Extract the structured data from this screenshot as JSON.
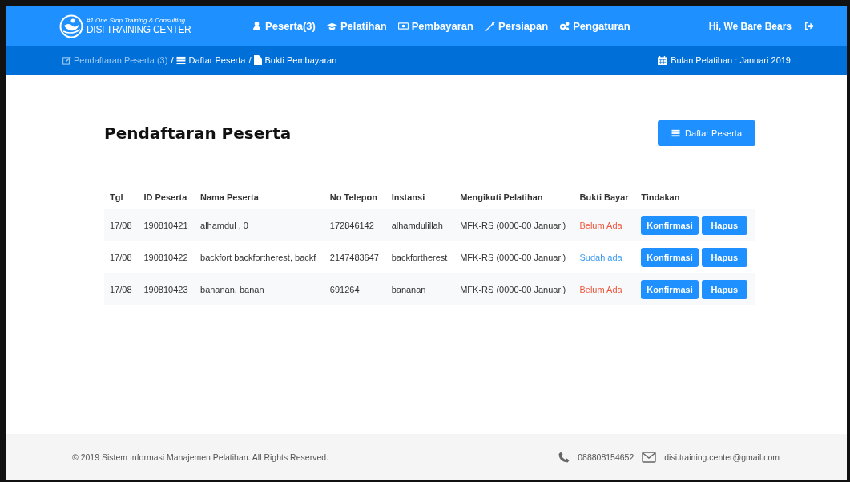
{
  "brand": {
    "tagline": "#1 One Stop Training & Consulting",
    "name": "DISI TRAINING CENTER"
  },
  "nav": [
    {
      "label": "Peserta(3)"
    },
    {
      "label": "Pelatihan"
    },
    {
      "label": "Pembayaran"
    },
    {
      "label": "Persiapan"
    },
    {
      "label": "Pengaturan"
    }
  ],
  "user": {
    "greeting": "Hi, We Bare Bears"
  },
  "breadcrumb": [
    {
      "label": "Pendaftaran Peserta (3)",
      "link": true
    },
    {
      "label": "Daftar Peserta",
      "link": false
    },
    {
      "label": "Bukti Pembayaran",
      "link": false
    }
  ],
  "breadcrumb_separator": "/",
  "period": "Bulan Pelatihan : Januari 2019",
  "page_title": "Pendaftaran Peserta",
  "list_button": "Daftar Peserta",
  "table": {
    "columns": [
      "Tgl",
      "ID Peserta",
      "Nama Peserta",
      "No Telepon",
      "Instansi",
      "Mengikuti Pelatihan",
      "Bukti Bayar",
      "Tindakan"
    ],
    "rows": [
      {
        "tgl": "17/08",
        "id": "190810421",
        "nama": "alhamdul , 0",
        "telepon": "172846142",
        "instansi": "alhamdulillah",
        "pelatihan": "MFK-RS (0000-00 Januari)",
        "bukti": "Belum Ada",
        "paid": false,
        "actions": [
          "Konfirmasi",
          "Hapus"
        ]
      },
      {
        "tgl": "17/08",
        "id": "190810422",
        "nama": "backfort backfortherest, backf",
        "telepon": "2147483647",
        "instansi": "backfortherest",
        "pelatihan": "MFK-RS (0000-00 Januari)",
        "bukti": "Sudah ada",
        "paid": true,
        "actions": [
          "Konfirmasi",
          "Hapus"
        ]
      },
      {
        "tgl": "17/08",
        "id": "190810423",
        "nama": "bananan, banan",
        "telepon": "691264",
        "instansi": "bananan",
        "pelatihan": "MFK-RS (0000-00 Januari)",
        "bukti": "Belum Ada",
        "paid": false,
        "actions": [
          "Konfirmasi",
          "Hapus"
        ]
      }
    ]
  },
  "footer": {
    "copyright": "© 2019 Sistem Informasi Manajemen Pelatihan. All Rights Reserved.",
    "phone": "088808154652",
    "email": "disi.training.center@gmail.com"
  }
}
